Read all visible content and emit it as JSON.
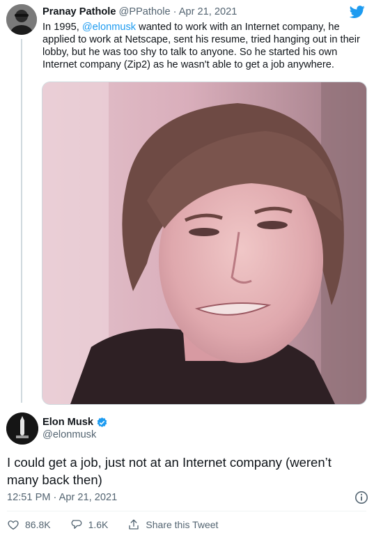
{
  "quoted_tweet": {
    "author_name": "Pranay Pathole",
    "handle": "@PPathole",
    "separator": "·",
    "date": "Apr 21, 2021",
    "text_prefix": "In 1995, ",
    "mention": "@elonmusk",
    "text_suffix": " wanted to work with an Internet company, he applied to work at Netscape, sent his resume, tried hanging out in their lobby, but he was too shy to talk to anyone. So he started his own Internet company (Zip2) as he wasn't able to get a job anywhere.",
    "avatar_icon": "person-avatar-icon",
    "photo_subject": "young-man-portrait"
  },
  "brand": {
    "icon": "twitter-bird-icon",
    "color": "#1d9bf0"
  },
  "main_tweet": {
    "author_name": "Elon Musk",
    "verified_icon": "verified-badge-icon",
    "handle": "@elonmusk",
    "text": "I could get a job, just not at an Internet company (weren’t many back then)",
    "timestamp": "12:51 PM · Apr 21, 2021",
    "info_icon": "info-icon"
  },
  "actions": {
    "like_count": "86.8K",
    "reply_count": "1.6K",
    "share_label": "Share this Tweet"
  }
}
